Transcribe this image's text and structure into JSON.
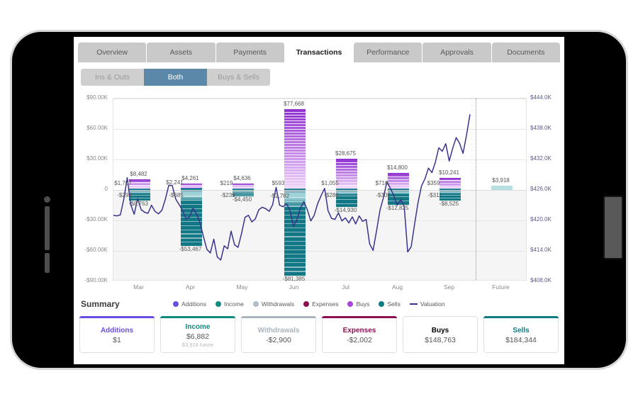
{
  "device": {
    "camera_icon": "camera-dot",
    "volume_up_icon": "volume-up-button",
    "volume_down_icon": "volume-down-button",
    "power_icon": "power-button"
  },
  "tabs": [
    {
      "label": "Overview",
      "active": false
    },
    {
      "label": "Assets",
      "active": false
    },
    {
      "label": "Payments",
      "active": false
    },
    {
      "label": "Transactions",
      "active": true
    },
    {
      "label": "Performance",
      "active": false
    },
    {
      "label": "Approvals",
      "active": false
    },
    {
      "label": "Documents",
      "active": false
    }
  ],
  "segments": [
    {
      "label": "Ins & Outs",
      "active": false
    },
    {
      "label": "Both",
      "active": true
    },
    {
      "label": "Buys & Sells",
      "active": false
    }
  ],
  "summary": {
    "title": "Summary",
    "cards": [
      {
        "title": "Additions",
        "value": "$1",
        "sub": "",
        "color": "#6a4ce0"
      },
      {
        "title": "Income",
        "value": "$6,882",
        "sub": "$3,918 future",
        "color": "#0f8a7e"
      },
      {
        "title": "Withdrawals",
        "value": "-$2,900",
        "sub": "",
        "color": "#aab4bd"
      },
      {
        "title": "Expenses",
        "value": "-$2,002",
        "sub": "",
        "color": "#8c0f52"
      },
      {
        "title": "Buys",
        "value": "$148,763",
        "sub": "",
        "color": "#a githubPlaceholder"
      },
      {
        "title": "Sells",
        "value": "$184,344",
        "sub": "",
        "color": "#0f7b84"
      }
    ]
  },
  "legend": [
    {
      "label": "Additions",
      "color": "#6a4ce0",
      "shape": "dot"
    },
    {
      "label": "Income",
      "color": "#0f8a7e",
      "shape": "dot"
    },
    {
      "label": "Withdrawals",
      "color": "#b0bcc6",
      "shape": "dot"
    },
    {
      "label": "Expenses",
      "color": "#8c0f52",
      "shape": "dot"
    },
    {
      "label": "Buys",
      "color": "#ab47e0",
      "shape": "dot"
    },
    {
      "label": "Sells",
      "color": "#0f7b84",
      "shape": "dot"
    },
    {
      "label": "Valuation",
      "color": "#38348c",
      "shape": "line"
    }
  ],
  "chart_data": {
    "type": "bar",
    "title": "",
    "xlabel": "",
    "ylabel": "",
    "categories": [
      "Mar",
      "Apr",
      "May",
      "Jun",
      "Jul",
      "Aug",
      "Sep",
      "Future"
    ],
    "y_left_label": "",
    "y_left_ticks": [
      "$90.00K",
      "$60.00K",
      "$30.00K",
      "0",
      "-$30.00K",
      "-$60.00K",
      "-$90.00K"
    ],
    "y_left_values": [
      90000,
      60000,
      30000,
      0,
      -30000,
      -60000,
      -90000
    ],
    "ylim": [
      -90000,
      90000
    ],
    "y_right_label": "",
    "y_right_ticks": [
      "$444.0K",
      "$438.0K",
      "$432.0K",
      "$426.0K",
      "$420.0K",
      "$414.0K",
      "$408.0K"
    ],
    "y_right_values": [
      444000,
      438000,
      432000,
      426000,
      420000,
      414000,
      408000
    ],
    "y_right_lim": [
      408000,
      444000
    ],
    "grid": true,
    "legend_position": "top",
    "future_divider_after": "Sep",
    "bars": [
      {
        "category": "Mar",
        "pos_total": 1707,
        "pos_label": "$1,707",
        "neg_total": -294,
        "neg_label": "-$294",
        "extra_pos_total": 8482,
        "extra_pos_label": "$8,482",
        "extra_neg_total": -8763,
        "extra_neg_label": "-$8,763"
      },
      {
        "category": "Apr",
        "pos_total": 2241,
        "pos_label": "$2,241",
        "neg_total": -685,
        "neg_label": "-$685",
        "extra_pos_total": 4261,
        "extra_pos_label": "$4,261",
        "extra_neg_total": -53467,
        "extra_neg_label": "-$53,467"
      },
      {
        "category": "May",
        "pos_total": 219,
        "pos_label": "$219",
        "neg_total": -239,
        "neg_label": "-$239",
        "extra_pos_total": 4636,
        "extra_pos_label": "$4,636",
        "extra_neg_total": -4450,
        "extra_neg_label": "-$4,450"
      },
      {
        "category": "Jun",
        "pos_total": 593,
        "pos_label": "$593",
        "neg_total": -2782,
        "neg_label": "-$2,782",
        "extra_pos_total": 77668,
        "extra_pos_label": "$77,668",
        "extra_neg_total": -81385,
        "extra_neg_label": "-$81,385"
      },
      {
        "category": "Jul",
        "pos_total": 1055,
        "pos_label": "$1,055",
        "neg_total": -286,
        "neg_label": "-$286",
        "extra_pos_total": 28675,
        "extra_pos_label": "$28,675",
        "extra_neg_total": -14930,
        "extra_neg_label": "-$14,930"
      },
      {
        "category": "Aug",
        "pos_total": 710,
        "pos_label": "$710",
        "neg_total": -305,
        "neg_label": "-$305",
        "extra_pos_total": 14800,
        "extra_pos_label": "$14,800",
        "extra_neg_total": -12825,
        "extra_neg_label": "-$12,825"
      },
      {
        "category": "Sep",
        "pos_total": 359,
        "pos_label": "$359",
        "neg_total": -311,
        "neg_label": "-$311",
        "extra_pos_total": 10241,
        "extra_pos_label": "$10,241",
        "extra_neg_total": -8525,
        "extra_neg_label": "-$8,525"
      },
      {
        "category": "Future",
        "pos_total": 3918,
        "pos_label": "$3,918",
        "neg_total": 0,
        "neg_label": "",
        "extra_pos_total": 0,
        "extra_pos_label": "",
        "extra_neg_total": 0,
        "extra_neg_label": ""
      }
    ],
    "series": [
      {
        "name": "Additions",
        "color": "#6a4ce0",
        "values": [
          1707,
          2241,
          219,
          593,
          1055,
          710,
          359,
          0
        ]
      },
      {
        "name": "Income",
        "color": "#0f8a7e",
        "values": [
          0,
          0,
          0,
          0,
          0,
          0,
          0,
          3918
        ]
      },
      {
        "name": "Withdrawals",
        "color": "#b0bcc6",
        "values": [
          -294,
          -685,
          -239,
          -2782,
          -286,
          -305,
          -311,
          0
        ]
      },
      {
        "name": "Expenses",
        "color": "#8c0f52",
        "values": [
          0,
          0,
          0,
          0,
          0,
          0,
          0,
          0
        ]
      },
      {
        "name": "Buys",
        "color": "#ab47e0",
        "values": [
          8482,
          4261,
          4636,
          77668,
          28675,
          14800,
          10241,
          0
        ]
      },
      {
        "name": "Sells",
        "color": "#0f7b84",
        "values": [
          -8763,
          -53467,
          -4450,
          -81385,
          -14930,
          -12825,
          -8525,
          0
        ]
      }
    ],
    "valuation": {
      "name": "Valuation",
      "color": "#38348c",
      "axis": "right",
      "values": [
        421000,
        420900,
        421100,
        424200,
        428400,
        423100,
        421200,
        424300,
        422100,
        421600,
        421400,
        423000,
        421800,
        421300,
        422000,
        424200,
        426900,
        426850,
        424200,
        423100,
        421900,
        420300,
        420700,
        422400,
        421300,
        419600,
        416800,
        414300,
        413600,
        416300,
        412800,
        412200,
        415000,
        414400,
        417900,
        415200,
        414700,
        417400,
        420600,
        421000,
        419700,
        420300,
        422100,
        422600,
        422300,
        421800,
        423100,
        426500,
        423000,
        422700,
        423300,
        422000,
        418800,
        420100,
        422400,
        423700,
        422100,
        419900,
        421000,
        423300,
        424900,
        426300,
        421900,
        420400,
        420200,
        421500,
        419900,
        420500,
        419500,
        420700,
        419300,
        420900,
        419800,
        420200,
        415400,
        414100,
        417900,
        422000,
        424500,
        427600,
        426300,
        424900,
        423000,
        424100,
        422800,
        413800,
        414800,
        419300,
        423500,
        426800,
        428200,
        430300,
        429400,
        431500,
        434300,
        433600,
        435100,
        431700,
        434200,
        436300,
        435200,
        433200,
        436800,
        440900
      ]
    }
  }
}
